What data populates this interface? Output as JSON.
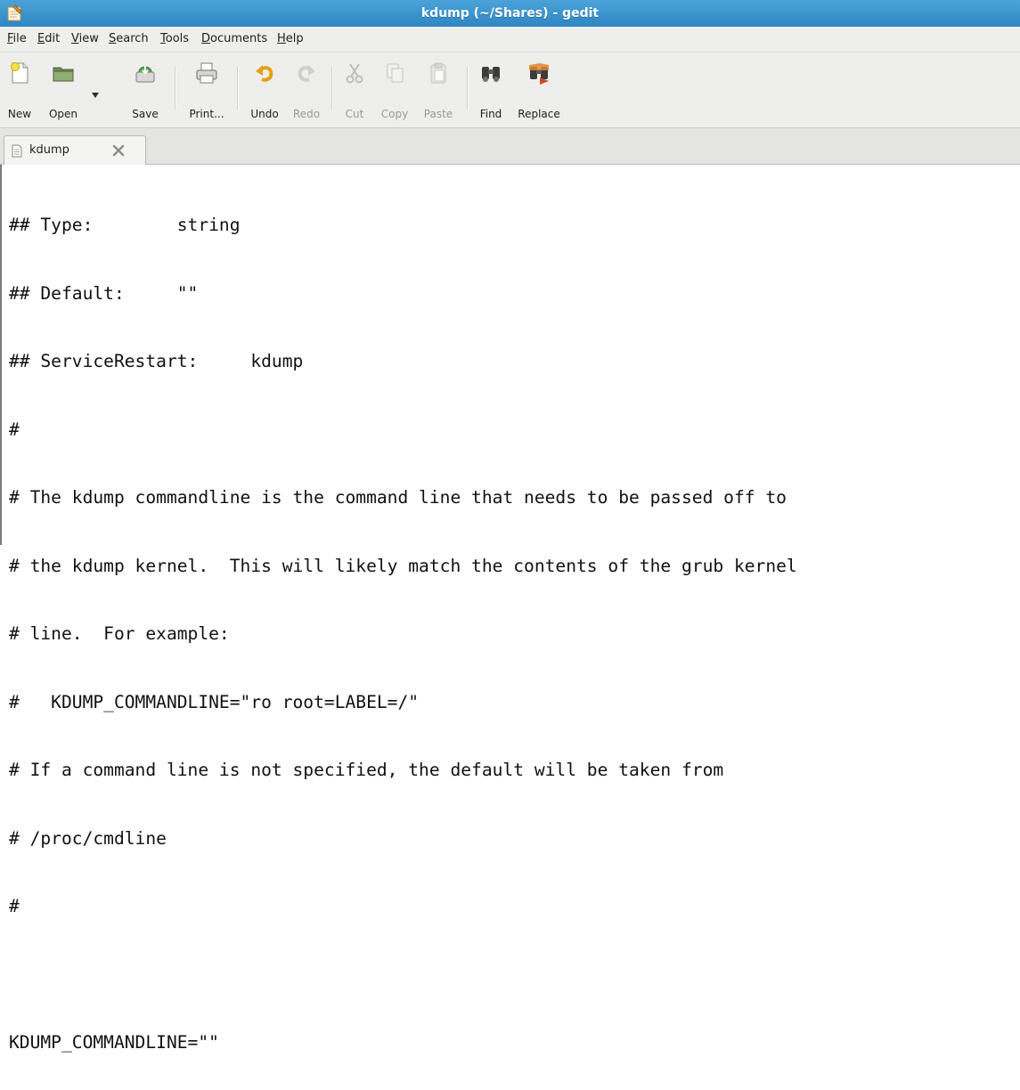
{
  "window": {
    "title": "kdump (~/Shares) - gedit",
    "app_icon": "gedit-notepad-icon"
  },
  "menubar": {
    "items": [
      {
        "label": "File",
        "mnemonic": "F"
      },
      {
        "label": "Edit",
        "mnemonic": "E"
      },
      {
        "label": "View",
        "mnemonic": "V"
      },
      {
        "label": "Search",
        "mnemonic": "S"
      },
      {
        "label": "Tools",
        "mnemonic": "T"
      },
      {
        "label": "Documents",
        "mnemonic": "D"
      },
      {
        "label": "Help",
        "mnemonic": "H"
      }
    ]
  },
  "toolbar": {
    "new_label": "New",
    "open_label": "Open",
    "save_label": "Save",
    "print_label": "Print...",
    "undo_label": "Undo",
    "redo_label": "Redo",
    "cut_label": "Cut",
    "copy_label": "Copy",
    "paste_label": "Paste",
    "find_label": "Find",
    "replace_label": "Replace"
  },
  "tabs": [
    {
      "label": "kdump",
      "active": true
    }
  ],
  "editor": {
    "lines": [
      "## Type:        string",
      "## Default:     \"\"",
      "## ServiceRestart:     kdump",
      "#",
      "# The kdump commandline is the command line that needs to be passed off to",
      "# the kdump kernel.  This will likely match the contents of the grub kernel",
      "# line.  For example:",
      "#   KDUMP_COMMANDLINE=\"ro root=LABEL=/\"",
      "# If a command line is not specified, the default will be taken from",
      "# /proc/cmdline",
      "#",
      "",
      "KDUMP_COMMANDLINE=\"\""
    ]
  },
  "colors": {
    "titlebar": "#3a93cd",
    "chrome": "#eeeeec",
    "text": "#111111"
  }
}
